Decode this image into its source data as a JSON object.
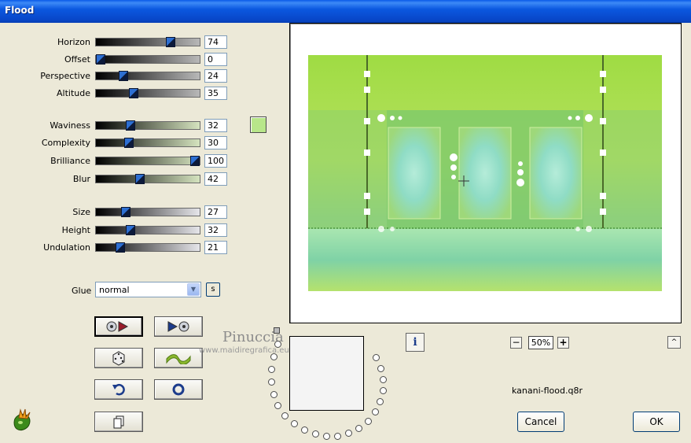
{
  "window": {
    "title": "Flood"
  },
  "params": [
    {
      "label": "Horizon",
      "value": "74",
      "pct": 0.74
    },
    {
      "label": "Offset",
      "value": "0",
      "pct": 0.0
    },
    {
      "label": "Perspective",
      "value": "24",
      "pct": 0.24
    },
    {
      "label": "Altitude",
      "value": "35",
      "pct": 0.35
    },
    {
      "label": "Waviness",
      "value": "32",
      "pct": 0.32
    },
    {
      "label": "Complexity",
      "value": "30",
      "pct": 0.3
    },
    {
      "label": "Brilliance",
      "value": "100",
      "pct": 1.0
    },
    {
      "label": "Blur",
      "value": "42",
      "pct": 0.42
    },
    {
      "label": "Size",
      "value": "27",
      "pct": 0.27
    },
    {
      "label": "Height",
      "value": "32",
      "pct": 0.32
    },
    {
      "label": "Undulation",
      "value": "21",
      "pct": 0.21
    }
  ],
  "color_swatch": "#b8e68a",
  "glue": {
    "label": "Glue",
    "value": "normal",
    "s_button": "s"
  },
  "preview": {
    "filename": "kanani-flood.q8r"
  },
  "zoom": {
    "value": "50%",
    "minus": "−",
    "plus": "+"
  },
  "info_label": "i",
  "caret_label": "^",
  "watermark": {
    "name": "Pinuccia",
    "url": "www.maidiregrafica.eu"
  },
  "buttons": {
    "cancel": "Cancel",
    "ok": "OK"
  }
}
